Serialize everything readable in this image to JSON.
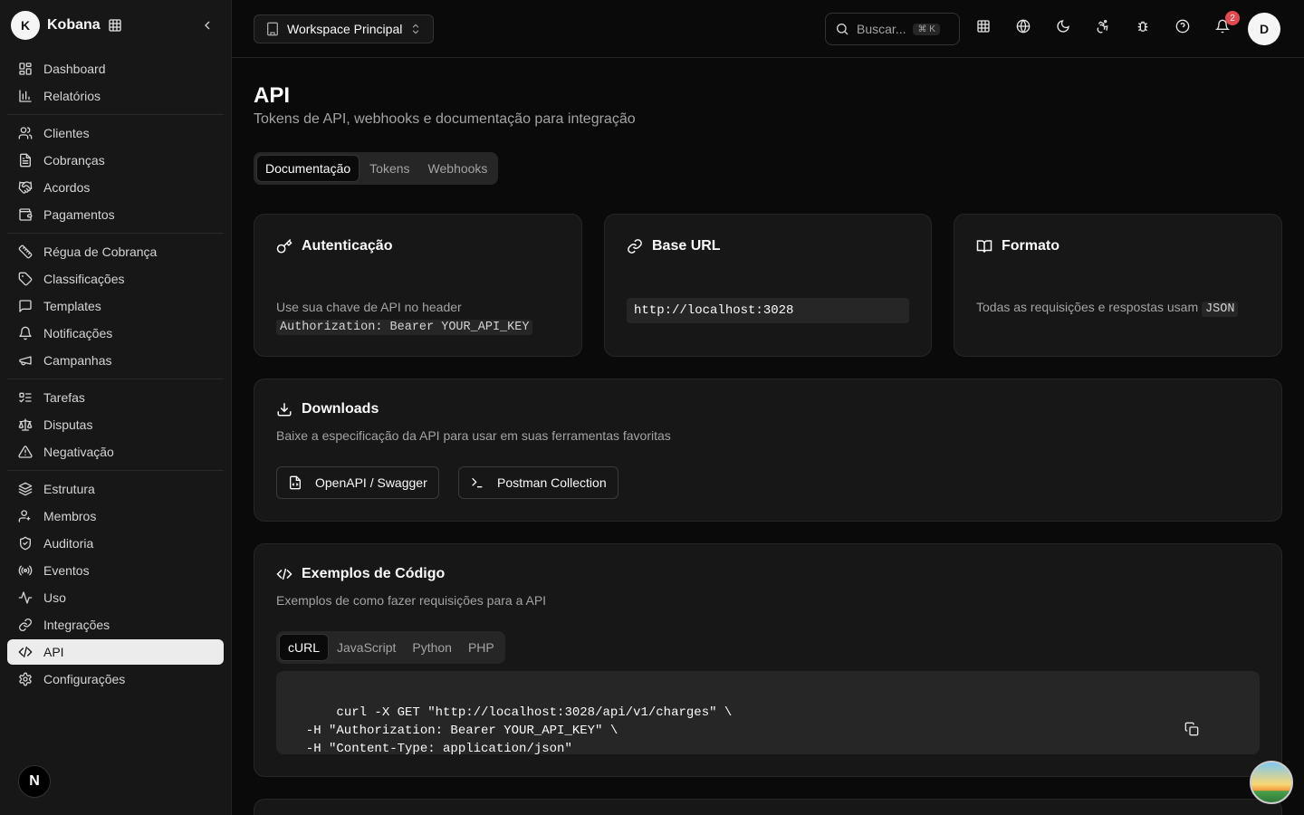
{
  "sidebar": {
    "logo_letter": "K",
    "brand": "Kobana",
    "groups": [
      [
        {
          "label": "Dashboard",
          "icon": "dashboard-icon"
        },
        {
          "label": "Relatórios",
          "icon": "bar-chart-icon"
        }
      ],
      [
        {
          "label": "Clientes",
          "icon": "users-icon"
        },
        {
          "label": "Cobranças",
          "icon": "receipt-icon"
        },
        {
          "label": "Acordos",
          "icon": "handshake-icon"
        },
        {
          "label": "Pagamentos",
          "icon": "wallet-icon"
        }
      ],
      [
        {
          "label": "Régua de Cobrança",
          "icon": "ruler-icon"
        },
        {
          "label": "Classificações",
          "icon": "tag-icon"
        },
        {
          "label": "Templates",
          "icon": "message-square-icon"
        },
        {
          "label": "Notificações",
          "icon": "bell-icon"
        },
        {
          "label": "Campanhas",
          "icon": "megaphone-icon"
        }
      ],
      [
        {
          "label": "Tarefas",
          "icon": "list-todo-icon"
        },
        {
          "label": "Disputas",
          "icon": "scale-icon"
        },
        {
          "label": "Negativação",
          "icon": "alert-triangle-icon"
        }
      ],
      [
        {
          "label": "Estrutura",
          "icon": "layers-icon"
        },
        {
          "label": "Membros",
          "icon": "user-group-icon"
        },
        {
          "label": "Auditoria",
          "icon": "shield-check-icon"
        },
        {
          "label": "Eventos",
          "icon": "radio-icon"
        },
        {
          "label": "Uso",
          "icon": "activity-icon"
        },
        {
          "label": "Integrações",
          "icon": "link-icon"
        },
        {
          "label": "API",
          "icon": "code-icon",
          "active": true
        },
        {
          "label": "Configurações",
          "icon": "settings-icon"
        }
      ]
    ],
    "footer_badge": "N"
  },
  "topbar": {
    "workspace": "Workspace Principal",
    "search_placeholder": "Buscar...",
    "search_shortcut": "⌘ K",
    "notification_count": "2",
    "avatar_letter": "D"
  },
  "page": {
    "title": "API",
    "subtitle": "Tokens de API, webhooks e documentação para integração",
    "tabs": [
      {
        "label": "Documentação",
        "active": true
      },
      {
        "label": "Tokens"
      },
      {
        "label": "Webhooks"
      }
    ]
  },
  "auth_card": {
    "title": "Autenticação",
    "text": "Use sua chave de API no header",
    "code": "Authorization: Bearer YOUR_API_KEY"
  },
  "base_url_card": {
    "title": "Base URL",
    "url": "http://localhost:3028"
  },
  "format_card": {
    "title": "Formato",
    "text": "Todas as requisições e respostas usam",
    "code": "JSON"
  },
  "downloads": {
    "title": "Downloads",
    "subtitle": "Baixe a especificação da API para usar em suas ferramentas favoritas",
    "openapi_label": "OpenAPI / Swagger",
    "postman_label": "Postman Collection"
  },
  "code_examples": {
    "title": "Exemplos de Código",
    "subtitle": "Exemplos de como fazer requisições para a API",
    "languages": [
      {
        "label": "cURL",
        "active": true
      },
      {
        "label": "JavaScript"
      },
      {
        "label": "Python"
      },
      {
        "label": "PHP"
      }
    ],
    "code": "curl -X GET \"http://localhost:3028/api/v1/charges\" \\\n  -H \"Authorization: Bearer YOUR_API_KEY\" \\\n  -H \"Content-Type: application/json\""
  }
}
